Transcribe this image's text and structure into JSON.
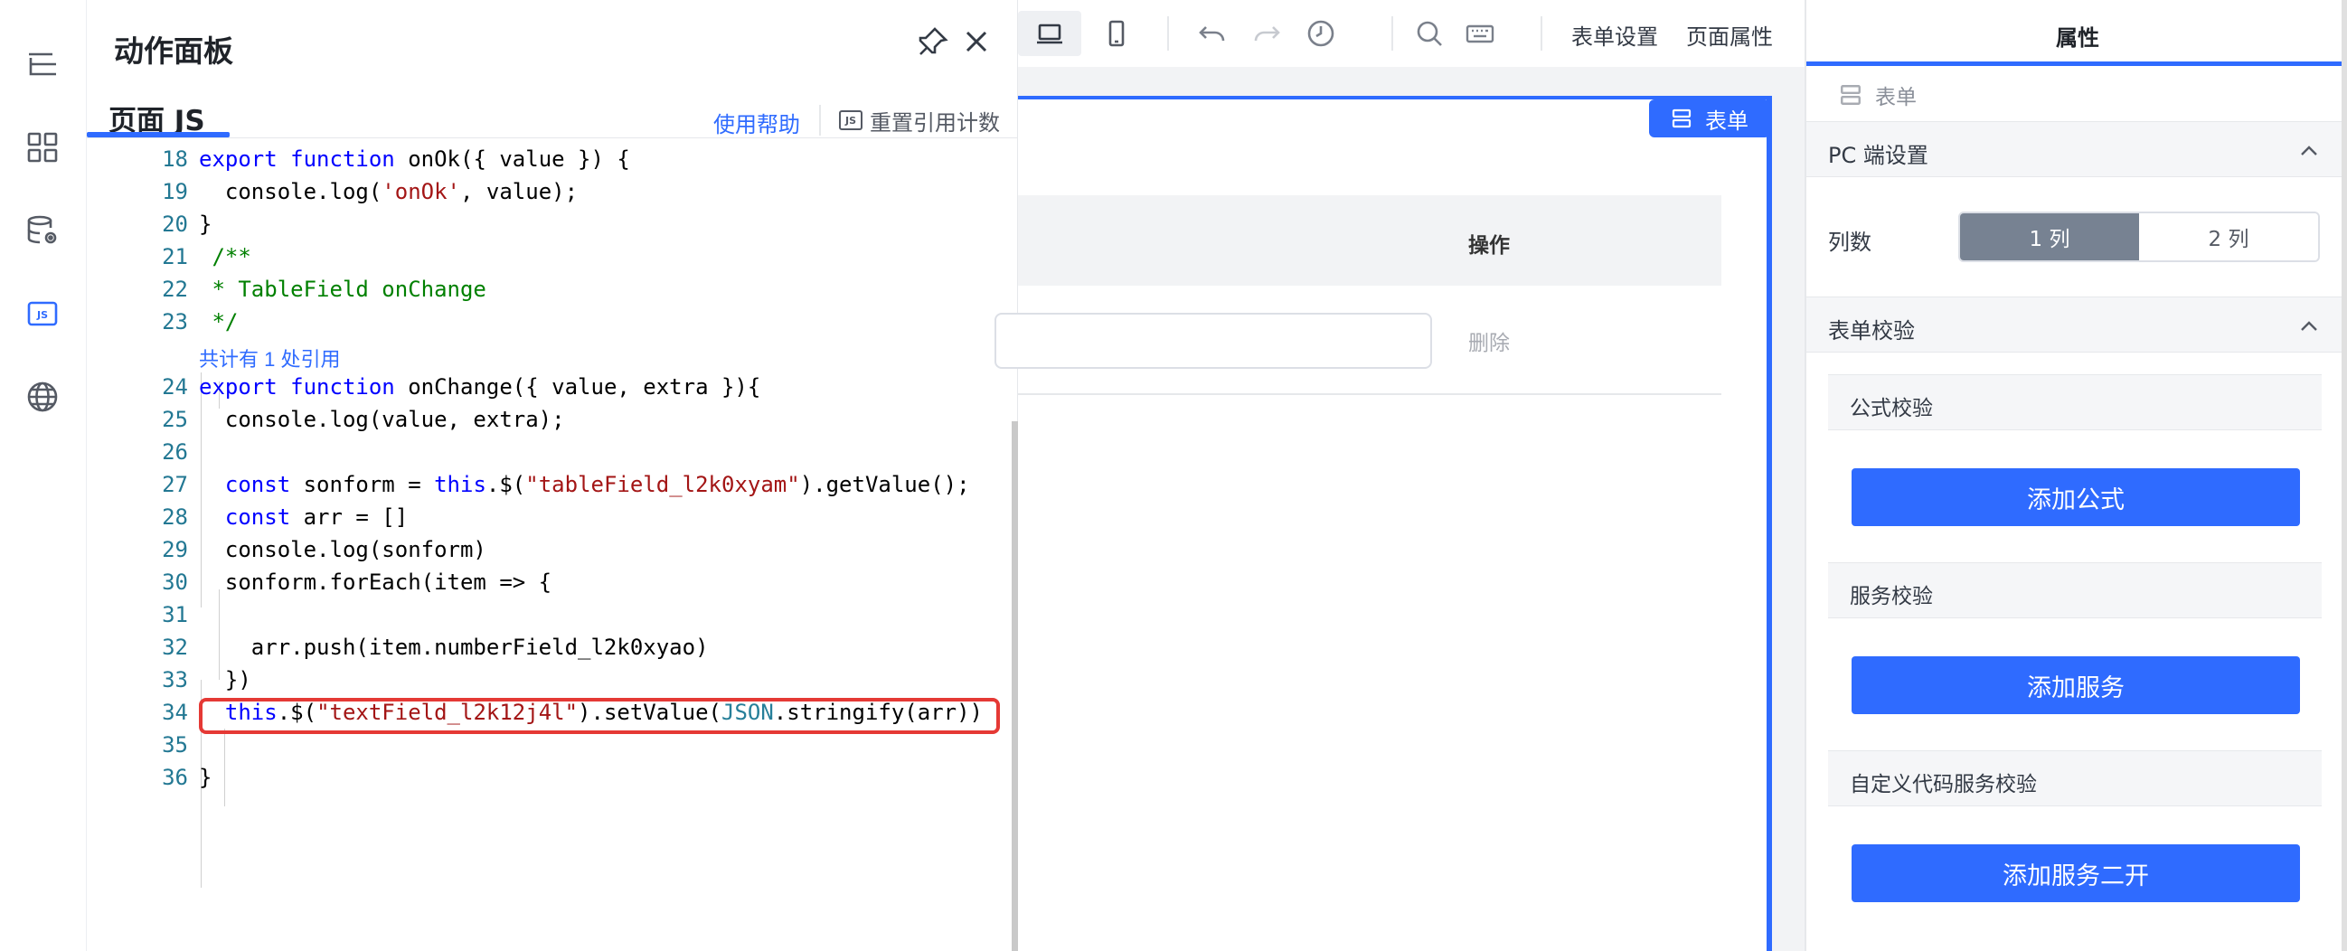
{
  "colors": {
    "accent": "#2f6bff",
    "highlight_box": "#e53935",
    "selected_segment": "#778292"
  },
  "rail": {
    "icons": [
      "outline-list-icon",
      "components-grid-icon",
      "data-source-icon",
      "js-icon",
      "globe-icon"
    ],
    "js_label": "JS"
  },
  "panel": {
    "title": "动作面板",
    "tab": "页面 JS",
    "help_link": "使用帮助",
    "reset_button": "重置引用计数",
    "reset_icon_label": "JS"
  },
  "code": {
    "codelens": "共计有 1 处引用",
    "lines": [
      {
        "no": "18"
      },
      {
        "no": "19"
      },
      {
        "no": "20"
      },
      {
        "no": "21"
      },
      {
        "no": "22"
      },
      {
        "no": "23"
      },
      {
        "no": "24"
      },
      {
        "no": "25"
      },
      {
        "no": "26"
      },
      {
        "no": "27"
      },
      {
        "no": "28"
      },
      {
        "no": "29"
      },
      {
        "no": "30"
      },
      {
        "no": "31"
      },
      {
        "no": "32"
      },
      {
        "no": "33"
      },
      {
        "no": "34"
      },
      {
        "no": "35"
      },
      {
        "no": "36"
      }
    ],
    "text": {
      "l18a": "export",
      "l18b": "function",
      "l18c": " onOk({ value }) {",
      "l19a": "  console.log(",
      "l19b": "'onOk'",
      "l19c": ", value);",
      "l20": "}",
      "l21": " /**",
      "l22": " * TableField onChange",
      "l23": " */",
      "l24a": "export",
      "l24b": "function",
      "l24c": " onChange({ value, extra }){",
      "l25": "  console.log(value, extra);",
      "l26": "",
      "l27a": "const",
      "l27b": " sonform = ",
      "l27c": "this",
      "l27d": ".$(",
      "l27e": "\"tableField_l2k0xyam\"",
      "l27f": ").getValue();",
      "l28a": "const",
      "l28b": " arr = []",
      "l29": "  console.log(sonform)",
      "l30": "  sonform.forEach(item => {",
      "l31": "",
      "l32": "    arr.push(item.numberField_l2k0xyao)",
      "l33": "  })",
      "l34a": "this",
      "l34b": ".$(",
      "l34c": "\"textField_l2k12j4l\"",
      "l34d": ").setValue(",
      "l34e": "JSON",
      "l34f": ".stringify(arr))",
      "l35": "",
      "l36": "}"
    }
  },
  "toolbar": {
    "form_settings": "表单设置",
    "page_props": "页面属性"
  },
  "canvas": {
    "form_badge": "表单",
    "op_header": "操作",
    "delete_link": "删除"
  },
  "props": {
    "title": "属性",
    "crumb": "表单",
    "pc_settings": "PC 端设置",
    "cols_label": "列数",
    "col_one": "1 列",
    "col_two": "2 列",
    "form_validation": "表单校验",
    "formula_validation": "公式校验",
    "add_formula": "添加公式",
    "service_validation": "服务校验",
    "add_service": "添加服务",
    "custom_validation": "自定义代码服务校验",
    "add_service_dev": "添加服务二开"
  }
}
